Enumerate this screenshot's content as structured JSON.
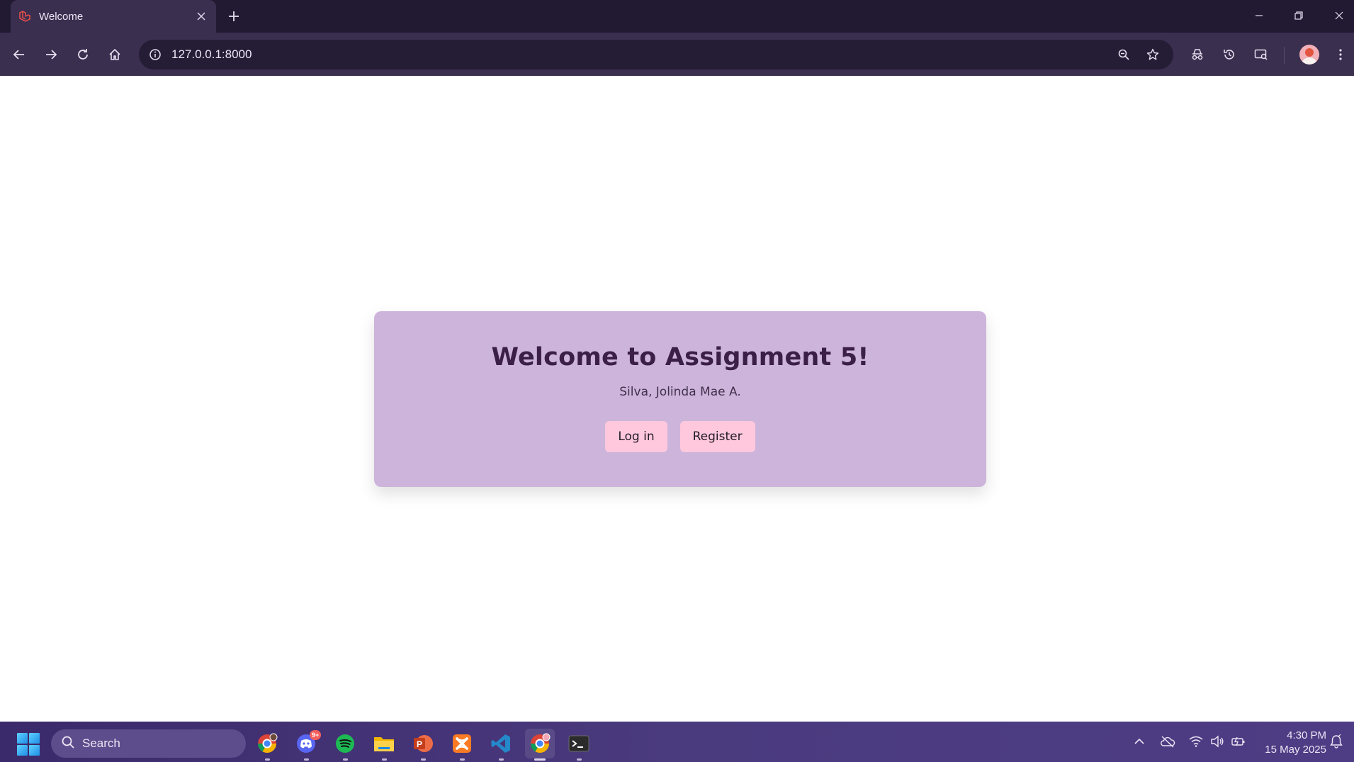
{
  "browser": {
    "tab": {
      "title": "Welcome",
      "favicon": "laravel-icon"
    },
    "address": {
      "url": "127.0.0.1:8000"
    },
    "window_controls": [
      "minimize-icon",
      "restore-icon",
      "close-icon"
    ]
  },
  "page": {
    "heading": "Welcome to Assignment 5!",
    "author": "Silva, Jolinda Mae A.",
    "buttons": {
      "login": "Log in",
      "register": "Register"
    }
  },
  "taskbar": {
    "search_label": "Search",
    "apps": [
      "chrome-profile-icon",
      "discord-icon",
      "spotify-icon",
      "file-explorer-icon",
      "powerpoint-icon",
      "xampp-icon",
      "vscode-icon",
      "chrome-icon",
      "terminal-icon"
    ],
    "discord_badge": "9+",
    "time": "4:30 PM",
    "date": "15 May 2025"
  },
  "colors": {
    "card": "#cdb4db",
    "button": "#ffc8dd",
    "heading": "#3b1f46",
    "chrome_dark": "#211a32",
    "chrome_toolbar": "#3a2f4f"
  }
}
